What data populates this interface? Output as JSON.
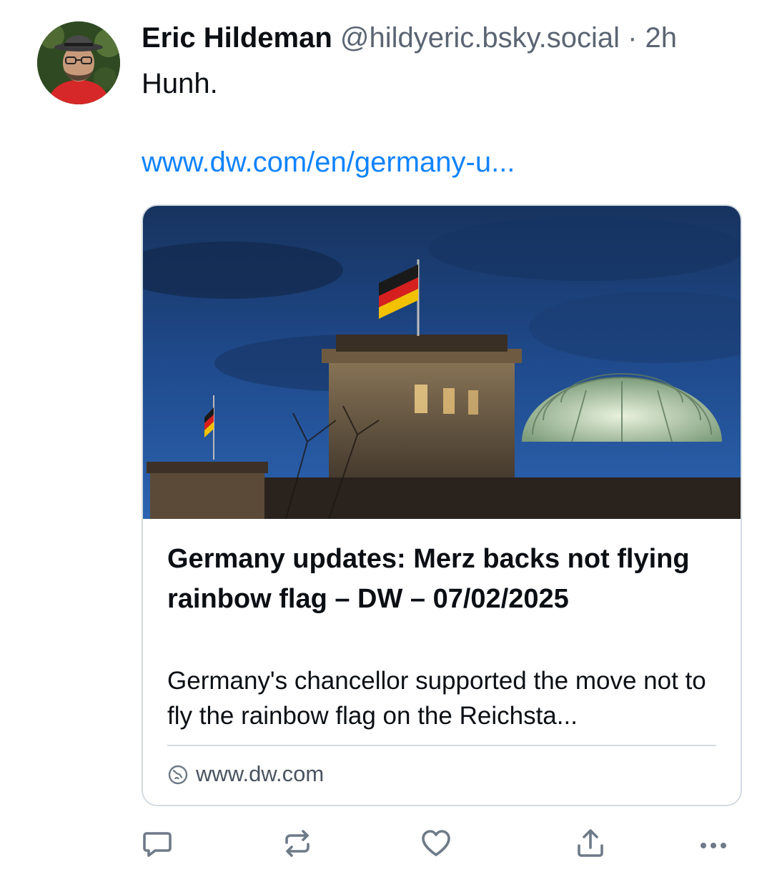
{
  "post": {
    "author": {
      "display_name": "Eric Hildeman",
      "handle": "@hildyeric.bsky.social",
      "separator": " · ",
      "timestamp": "2h",
      "avatar_icon": "user-avatar"
    },
    "text": "Hunh.",
    "link_text": "www.dw.com/en/germany-u...",
    "link_color": "#1083fe",
    "embed": {
      "image_icon": "reichstag-photo",
      "title": "Germany updates: Merz backs not flying rainbow flag – DW – 07/02/2025",
      "description": "Germany's chancellor supported the move not to fly the rainbow flag on the Reichsta...",
      "domain": "www.dw.com",
      "domain_icon": "globe-icon"
    },
    "actions": {
      "reply_icon": "reply-icon",
      "repost_icon": "repost-icon",
      "like_icon": "heart-icon",
      "share_icon": "share-icon",
      "more_icon": "more-icon",
      "icon_color": "#6e7a88"
    }
  }
}
